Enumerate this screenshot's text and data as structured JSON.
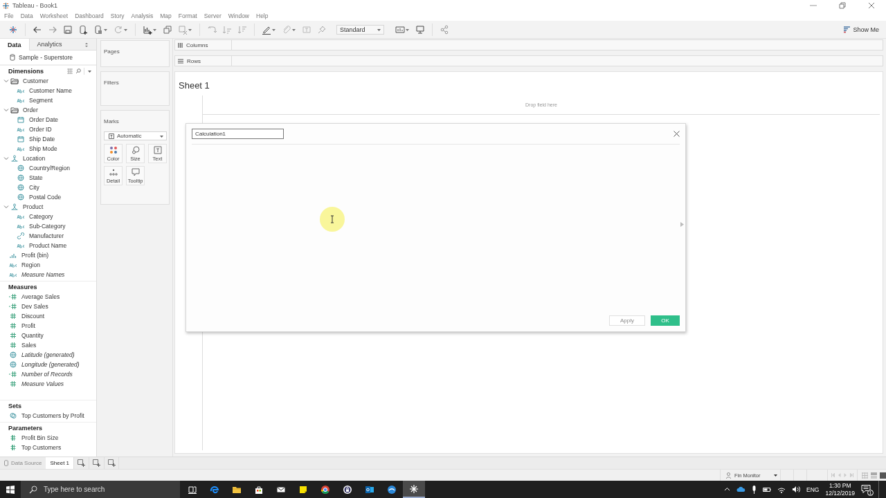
{
  "window": {
    "title": "Tableau - Book1"
  },
  "menu": [
    "File",
    "Data",
    "Worksheet",
    "Dashboard",
    "Story",
    "Analysis",
    "Map",
    "Format",
    "Server",
    "Window",
    "Help"
  ],
  "toolbar": {
    "view_mode": "Standard",
    "show_me": "Show Me"
  },
  "data_pane": {
    "tabs": [
      {
        "label": "Data",
        "selected": true
      },
      {
        "label": "Analytics",
        "selected": false
      }
    ],
    "data_source": "Sample - Superstore",
    "sections": [
      {
        "title": "Dimensions",
        "tools": true,
        "items": [
          {
            "name": "Customer",
            "kind": "folder",
            "expanded": true,
            "children": [
              {
                "name": "Customer Name",
                "kind": "text",
                "generated": false
              },
              {
                "name": "Segment",
                "kind": "text",
                "generated": false
              }
            ]
          },
          {
            "name": "Order",
            "kind": "folder",
            "expanded": true,
            "children": [
              {
                "name": "Order Date",
                "kind": "date",
                "generated": false
              },
              {
                "name": "Order ID",
                "kind": "text",
                "generated": false
              },
              {
                "name": "Ship Date",
                "kind": "date",
                "generated": false
              },
              {
                "name": "Ship Mode",
                "kind": "text",
                "generated": false
              }
            ]
          },
          {
            "name": "Location",
            "kind": "hierarchy",
            "expanded": true,
            "children": [
              {
                "name": "Country/Region",
                "kind": "geo",
                "generated": false
              },
              {
                "name": "State",
                "kind": "geo",
                "generated": false
              },
              {
                "name": "City",
                "kind": "geo",
                "generated": false
              },
              {
                "name": "Postal Code",
                "kind": "geo",
                "generated": false
              }
            ]
          },
          {
            "name": "Product",
            "kind": "hierarchy",
            "expanded": true,
            "children": [
              {
                "name": "Category",
                "kind": "text",
                "generated": false
              },
              {
                "name": "Sub-Category",
                "kind": "text",
                "generated": false
              },
              {
                "name": "Manufacturer",
                "kind": "link",
                "generated": false
              },
              {
                "name": "Product Name",
                "kind": "text",
                "generated": false
              }
            ]
          },
          {
            "name": "Profit (bin)",
            "kind": "bin",
            "generated": false
          },
          {
            "name": "Region",
            "kind": "text",
            "generated": false
          },
          {
            "name": "Measure Names",
            "kind": "text",
            "generated": true
          }
        ]
      },
      {
        "title": "Measures",
        "tools": false,
        "items": [
          {
            "name": "Average Sales",
            "kind": "calc",
            "generated": false
          },
          {
            "name": "Dev Sales",
            "kind": "calc",
            "generated": false
          },
          {
            "name": "Discount",
            "kind": "measure",
            "generated": false
          },
          {
            "name": "Profit",
            "kind": "measure",
            "generated": false
          },
          {
            "name": "Quantity",
            "kind": "measure",
            "generated": false
          },
          {
            "name": "Sales",
            "kind": "measure",
            "generated": false
          },
          {
            "name": "Latitude (generated)",
            "kind": "geo",
            "generated": true
          },
          {
            "name": "Longitude (generated)",
            "kind": "geo",
            "generated": true
          },
          {
            "name": "Number of Records",
            "kind": "calc",
            "generated": true
          },
          {
            "name": "Measure Values",
            "kind": "measure",
            "generated": true
          }
        ]
      },
      {
        "title": "Sets",
        "tools": false,
        "items": [
          {
            "name": "Top Customers by Profit",
            "kind": "set",
            "generated": false
          }
        ]
      },
      {
        "title": "Parameters",
        "tools": false,
        "items": [
          {
            "name": "Profit Bin Size",
            "kind": "param",
            "generated": false
          },
          {
            "name": "Top Customers",
            "kind": "param",
            "generated": false
          }
        ]
      }
    ]
  },
  "shelves": {
    "pages": "Pages",
    "filters": "Filters",
    "columns": "Columns",
    "rows": "Rows"
  },
  "marks": {
    "title": "Marks",
    "mark_type": "Automatic",
    "cards": [
      {
        "label": "Color",
        "kind": "color"
      },
      {
        "label": "Size",
        "kind": "size"
      },
      {
        "label": "Text",
        "kind": "text"
      },
      {
        "label": "Detail",
        "kind": "detail"
      },
      {
        "label": "Tooltip",
        "kind": "tooltip"
      }
    ]
  },
  "sheet": {
    "title": "Sheet 1",
    "drop_hint": "Drop field here"
  },
  "dialog": {
    "name_field": "Calculation1",
    "buttons": [
      {
        "label": "Apply",
        "kind": "apply",
        "disabled": true
      },
      {
        "label": "OK",
        "kind": "ok",
        "disabled": false
      }
    ]
  },
  "sheet_tabs": [
    {
      "label": "Data Source",
      "kind": "source",
      "selected": false
    },
    {
      "label": "Sheet 1",
      "kind": "sheet",
      "selected": true
    }
  ],
  "status_bar": {
    "user": "Fin Monitor"
  },
  "taskbar": {
    "search_placeholder": "Type here to search",
    "apps": [
      {
        "kind": "taskview",
        "active": false
      },
      {
        "kind": "browser",
        "active": false
      },
      {
        "kind": "files",
        "active": false
      },
      {
        "kind": "store",
        "active": false
      },
      {
        "kind": "mail",
        "active": false
      },
      {
        "kind": "notes",
        "active": false
      },
      {
        "kind": "chrome",
        "active": false
      },
      {
        "kind": "vpn",
        "active": false
      },
      {
        "kind": "outlook",
        "active": false
      },
      {
        "kind": "remote",
        "active": false
      },
      {
        "kind": "tableau",
        "active": true
      }
    ],
    "language": "ENG",
    "time": "1:30 PM",
    "date": "12/12/2019",
    "notifications": "1"
  }
}
